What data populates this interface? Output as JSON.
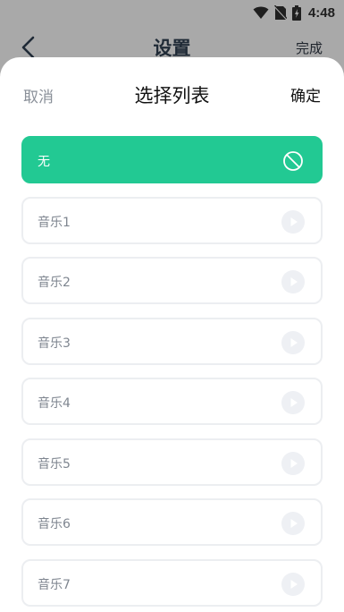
{
  "status_bar": {
    "time": "4:48",
    "icons": [
      "wifi-icon",
      "no-sim-icon",
      "battery-icon"
    ]
  },
  "page": {
    "title": "设置",
    "back_icon": "chevron-left-icon",
    "done_label": "完成"
  },
  "sheet": {
    "cancel_label": "取消",
    "title": "选择列表",
    "confirm_label": "确定",
    "items": [
      {
        "label": "无",
        "icon": "ban-icon",
        "selected": true
      },
      {
        "label": "音乐1",
        "icon": "play-icon",
        "selected": false
      },
      {
        "label": "音乐2",
        "icon": "play-icon",
        "selected": false
      },
      {
        "label": "音乐3",
        "icon": "play-icon",
        "selected": false
      },
      {
        "label": "音乐4",
        "icon": "play-icon",
        "selected": false
      },
      {
        "label": "音乐5",
        "icon": "play-icon",
        "selected": false
      },
      {
        "label": "音乐6",
        "icon": "play-icon",
        "selected": false
      },
      {
        "label": "音乐7",
        "icon": "play-icon",
        "selected": false
      }
    ]
  },
  "colors": {
    "accent": "#22c993",
    "overlay": "#a9a9a9",
    "item_border": "#eceef1",
    "muted_text": "#8a9099"
  }
}
